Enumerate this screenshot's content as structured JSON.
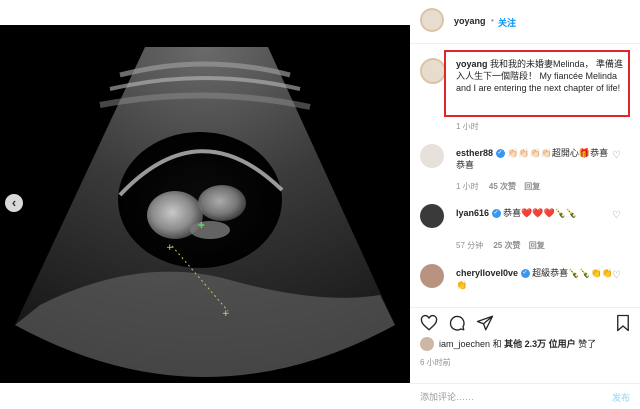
{
  "post": {
    "author": "yoyang",
    "separator": "•",
    "follow_label": "关注"
  },
  "caption": {
    "username": "yoyang",
    "text": "我和我的未婚妻Melinda， 準備進入人生下一個階段！ My fiancée Melinda and I are entering the next chapter of life!",
    "time": "1 小时"
  },
  "comments": [
    {
      "username": "esther88",
      "verified": true,
      "text": "👏🏻👏🏻👏🏻👏🏻超開心🎁恭喜恭喜",
      "time": "1 小时",
      "likes": "45 次赞",
      "reply": "回复"
    },
    {
      "username": "lyan616",
      "verified": true,
      "text": "恭喜❤️❤️❤️🍾🍾",
      "time": "57 分钟",
      "likes": "25 次赞",
      "reply": "回复"
    },
    {
      "username": "cheryllovel0ve",
      "verified": true,
      "text": "超級恭喜🍾🍾👏👏👏",
      "time": "",
      "likes": "",
      "reply": ""
    }
  ],
  "likes": {
    "first_user": "iam_joechen",
    "and": "和",
    "others": "其他 2.3万 位用户",
    "liked": "赞了"
  },
  "timestamp": "6 小时前",
  "add_comment": {
    "placeholder": "添加评论……",
    "post_label": "发布"
  },
  "colors": {
    "highlight": "#e0262a",
    "verified": "#3897f0",
    "follow": "#0095f6"
  }
}
